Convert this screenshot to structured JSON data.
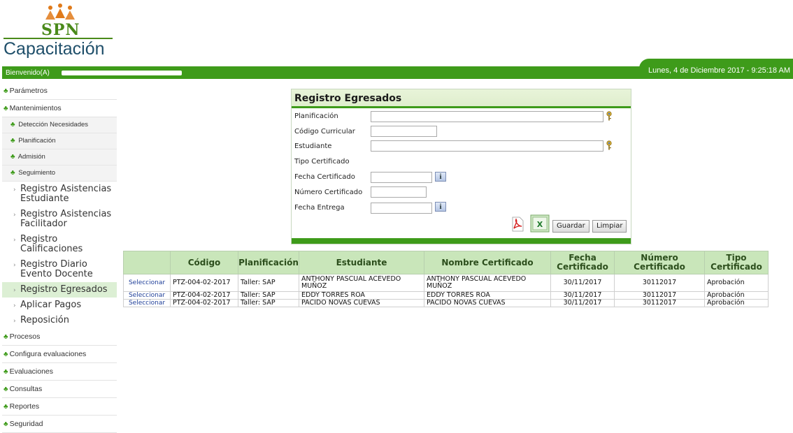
{
  "header": {
    "logo_text": "SPN",
    "logo_subtitle": "Capacitación",
    "welcome": "Bienvenido(A)",
    "datetime": "Lunes, 4 de Diciembre 2017 - 9:25:18 AM"
  },
  "sidebar": {
    "items": [
      {
        "label": "Parámetros"
      },
      {
        "label": "Mantenimientos"
      },
      {
        "label": "Detección Necesidades"
      },
      {
        "label": "Planificación"
      },
      {
        "label": "Admisión"
      },
      {
        "label": "Seguimiento"
      },
      {
        "label": "Registro Asistencias Estudiante"
      },
      {
        "label": "Registro Asistencias Facilitador"
      },
      {
        "label": "Registro Calificaciones"
      },
      {
        "label": "Registro Diario Evento Docente"
      },
      {
        "label": "Registro Egresados"
      },
      {
        "label": "Aplicar Pagos"
      },
      {
        "label": "Reposición"
      },
      {
        "label": "Procesos"
      },
      {
        "label": "Configura evaluaciones"
      },
      {
        "label": "Evaluaciones"
      },
      {
        "label": "Consultas"
      },
      {
        "label": "Reportes"
      },
      {
        "label": "Seguridad"
      }
    ],
    "active": "Registro Egresados"
  },
  "form": {
    "title": "Registro Egresados",
    "labels": {
      "planificacion": "Planificación",
      "codigo": "Código Curricular",
      "estudiante": "Estudiante",
      "tipo": "Tipo Certificado",
      "fecha_cert": "Fecha Certificado",
      "numero": "Número Certificado",
      "fecha_entrega": "Fecha Entrega"
    },
    "values": {
      "planificacion": "",
      "codigo": "",
      "estudiante": "",
      "fecha_cert": "",
      "numero": "",
      "fecha_entrega": ""
    },
    "buttons": {
      "save": "Guardar",
      "clear": "Limpiar"
    }
  },
  "table": {
    "headers": [
      "",
      "Código",
      "Planificación",
      "Estudiante",
      "Nombre Certificado",
      "Fecha Certificado",
      "Número Certificado",
      "Tipo Certificado"
    ],
    "select_label": "Seleccionar",
    "rows": [
      [
        "PTZ-004-02-2017",
        "Taller: SAP",
        "ANTHONY PASCUAL ACEVEDO MUÑOZ",
        "ANTHONY PASCUAL ACEVEDO MUÑOZ",
        "30/11/2017",
        "30112017",
        "Aprobación"
      ],
      [
        "PTZ-004-02-2017",
        "Taller: SAP",
        "EDDY TORRES ROA",
        "EDDY TORRES ROA",
        "30/11/2017",
        "30112017",
        "Aprobación"
      ],
      [
        "PTZ-004-02-2017",
        "Taller: SAP",
        "PACIDO NOVAS CUEVAS",
        "PACIDO NOVAS CUEVAS",
        "30/11/2017",
        "30112017",
        "Aprobación"
      ]
    ]
  },
  "colors": {
    "brand_green": "#3e9b1a",
    "header_cell": "#c9e6ba"
  }
}
